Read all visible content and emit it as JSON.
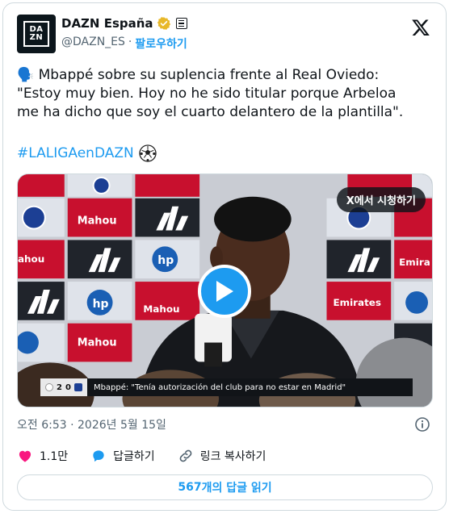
{
  "account": {
    "display_name": "DAZN España",
    "handle": "@DAZN_ES",
    "separator": "·",
    "follow_label": "팔로우하기",
    "avatar_text": "DA\nZN"
  },
  "tweet": {
    "text": "🗣️ Mbappé sobre su suplencia frente al Real Oviedo:\n\"Estoy muy bien. Hoy no he sido titular porque Arbeloa\nme ha dicho que soy el cuarto delantero de la plantilla\".",
    "hashtag": "#LALIGAenDAZN",
    "timestamp": "오전 6:53 · 2026년 5월 15일"
  },
  "media": {
    "watch_on_x_label": "X에서 시청하기",
    "ticker": {
      "home_score": "2",
      "away_score": "0",
      "caption": "Mbappé: \"Tenía autorización del club para no estar en Madrid\""
    },
    "sponsor_words": [
      "Mahou",
      "Emirates",
      "hp",
      "Emira",
      "ahou"
    ]
  },
  "actions": {
    "like_count": "1.1만",
    "reply_label": "답글하기",
    "copy_link_label": "링크 복사하기"
  },
  "read_replies": {
    "count": "567",
    "label": "개의 답글 읽기"
  },
  "colors": {
    "accent": "#1d9bf0",
    "like": "#f91880",
    "muted": "#536471",
    "verified_gold": "#e8b829"
  },
  "icons": [
    "verified-badge-icon",
    "affiliate-badge-icon",
    "x-logo-icon",
    "soccer-ball-icon",
    "play-icon",
    "info-icon",
    "heart-icon",
    "reply-icon",
    "link-icon"
  ]
}
